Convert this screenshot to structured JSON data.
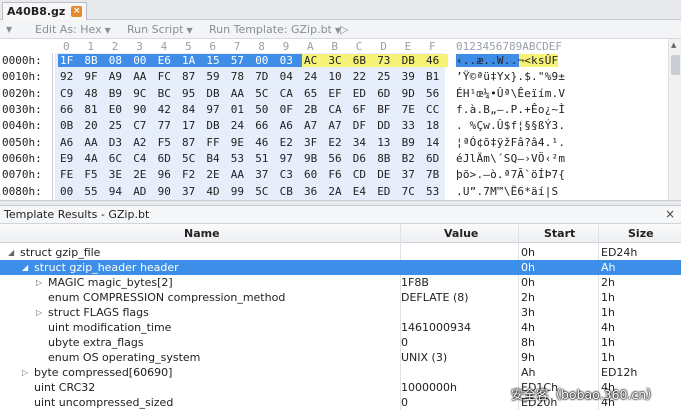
{
  "tab": {
    "filename": "A40B8.gz",
    "close": "×"
  },
  "toolbar": {
    "left_icon": "▼",
    "edit_as": "Edit As: Hex",
    "run_script": "Run Script",
    "run_template": "Run Template: GZip.bt",
    "play": "▷"
  },
  "hex": {
    "columns": [
      "0",
      "1",
      "2",
      "3",
      "4",
      "5",
      "6",
      "7",
      "8",
      "9",
      "A",
      "B",
      "C",
      "D",
      "E",
      "F"
    ],
    "ascii_header": "0123456789ABCDEF",
    "rows": [
      {
        "offset": "0000h:",
        "bytes": [
          "1F",
          "8B",
          "08",
          "00",
          "E6",
          "1A",
          "15",
          "57",
          "00",
          "03",
          "AC",
          "3C",
          "6B",
          "73",
          "DB",
          "46"
        ],
        "ascii": "‹..æ..W..¬<ksÛF"
      },
      {
        "offset": "0010h:",
        "bytes": [
          "92",
          "9F",
          "A9",
          "AA",
          "FC",
          "87",
          "59",
          "78",
          "7D",
          "04",
          "24",
          "10",
          "22",
          "25",
          "39",
          "B1"
        ],
        "ascii": "’Ÿ©ªü‡Yx}.$.\"%9±"
      },
      {
        "offset": "0020h:",
        "bytes": [
          "C9",
          "48",
          "B9",
          "9C",
          "BC",
          "95",
          "DB",
          "AA",
          "5C",
          "CA",
          "65",
          "EF",
          "ED",
          "6D",
          "9D",
          "56"
        ],
        "ascii": "ÉH¹œ¼•Ûª\\Êeïím.V"
      },
      {
        "offset": "0030h:",
        "bytes": [
          "66",
          "81",
          "E0",
          "90",
          "42",
          "84",
          "97",
          "01",
          "50",
          "0F",
          "2B",
          "CA",
          "6F",
          "BF",
          "7E",
          "CC"
        ],
        "ascii": "f.à.B„—.P.+Êo¿~Ì"
      },
      {
        "offset": "0040h:",
        "bytes": [
          "0B",
          "20",
          "25",
          "C7",
          "77",
          "17",
          "DB",
          "24",
          "66",
          "A6",
          "A7",
          "A7",
          "DF",
          "DD",
          "33",
          "18"
        ],
        "ascii": ". %Çw.Û$f¦§§ßÝ3."
      },
      {
        "offset": "0050h:",
        "bytes": [
          "A6",
          "AA",
          "D3",
          "A2",
          "F5",
          "87",
          "FF",
          "9E",
          "46",
          "E2",
          "3F",
          "E2",
          "34",
          "13",
          "B9",
          "14"
        ],
        "ascii": "¦ªÓ¢õ‡ÿžFâ?â4.¹."
      },
      {
        "offset": "0060h:",
        "bytes": [
          "E9",
          "4A",
          "6C",
          "C4",
          "6D",
          "5C",
          "B4",
          "53",
          "51",
          "97",
          "9B",
          "56",
          "D6",
          "8B",
          "B2",
          "6D"
        ],
        "ascii": "éJlÄm\\´SQ—›VÖ‹²m"
      },
      {
        "offset": "0070h:",
        "bytes": [
          "FE",
          "F5",
          "3E",
          "2E",
          "96",
          "F2",
          "2E",
          "AA",
          "37",
          "C3",
          "60",
          "F6",
          "CD",
          "DE",
          "37",
          "7B"
        ],
        "ascii": "þõ>.–ò.ª7Ã`öÍÞ7{"
      },
      {
        "offset": "0080h:",
        "bytes": [
          "00",
          "55",
          "94",
          "AD",
          "90",
          "37",
          "4D",
          "99",
          "5C",
          "CB",
          "36",
          "2A",
          "E4",
          "ED",
          "7C",
          "53"
        ],
        "ascii": ".U”­.7M™\\Ë6*äí|S"
      }
    ]
  },
  "panel": {
    "title": "Template Results - GZip.bt",
    "close": "×"
  },
  "table": {
    "headers": {
      "name": "Name",
      "value": "Value",
      "start": "Start",
      "size": "Size"
    },
    "rows": [
      {
        "tri": "◢",
        "name": "struct gzip_file",
        "value": "",
        "start": "0h",
        "size": "ED24h"
      },
      {
        "tri": "◢",
        "name": "struct gzip_header header",
        "value": "",
        "start": "0h",
        "size": "Ah"
      },
      {
        "tri": "▷",
        "name": "MAGIC magic_bytes[2]",
        "value": "1F8B",
        "start": "0h",
        "size": "2h"
      },
      {
        "tri": "",
        "name": "enum COMPRESSION compression_method",
        "value": "DEFLATE (8)",
        "start": "2h",
        "size": "1h"
      },
      {
        "tri": "▷",
        "name": "struct FLAGS flags",
        "value": "",
        "start": "3h",
        "size": "1h"
      },
      {
        "tri": "",
        "name": "uint modification_time",
        "value": "1461000934",
        "start": "4h",
        "size": "4h"
      },
      {
        "tri": "",
        "name": "ubyte extra_flags",
        "value": "0",
        "start": "8h",
        "size": "1h"
      },
      {
        "tri": "",
        "name": "enum OS operating_system",
        "value": "UNIX (3)",
        "start": "9h",
        "size": "1h"
      },
      {
        "tri": "▷",
        "name": "byte compressed[60690]",
        "value": "",
        "start": "Ah",
        "size": "ED12h"
      },
      {
        "tri": "",
        "name": "uint CRC32",
        "value": "1000000h",
        "start": "ED1Ch",
        "size": "4h"
      },
      {
        "tri": "",
        "name": "uint uncompressed_sized",
        "value": "0",
        "start": "ED20h",
        "size": "4h"
      }
    ]
  },
  "watermark": "安全客（bobao.360.cn）",
  "colors": {
    "selection": "#3d8ee8",
    "highlight": "#f5f276",
    "tab_close": "#e58a2e"
  }
}
